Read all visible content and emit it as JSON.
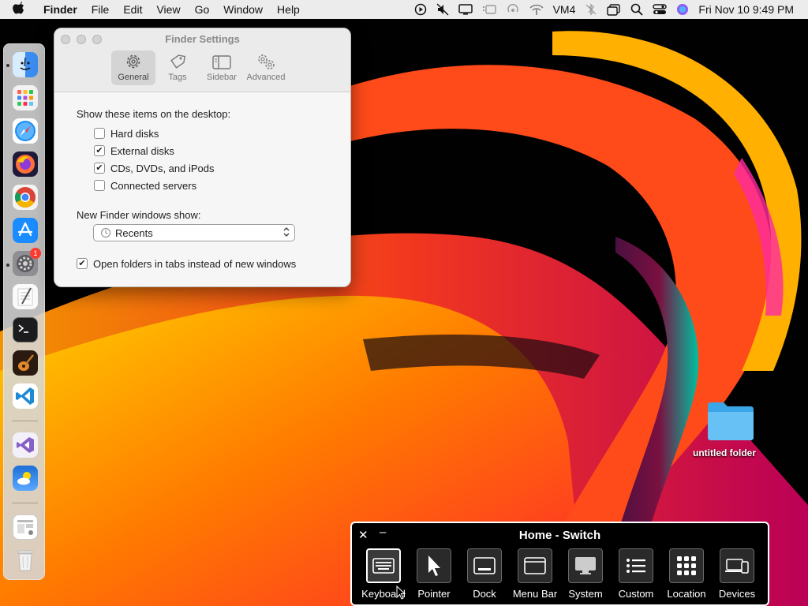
{
  "menubar": {
    "items": [
      "Finder",
      "File",
      "Edit",
      "View",
      "Go",
      "Window",
      "Help"
    ],
    "status_text": "VM4",
    "datetime": "Fri Nov 10  9:49 PM"
  },
  "dock": {
    "apps": [
      {
        "name": "finder-app",
        "glyph": "☺"
      },
      {
        "name": "launchpad-app",
        "glyph": "▦"
      },
      {
        "name": "safari-app",
        "glyph": "✦"
      },
      {
        "name": "firefox-app",
        "glyph": "●"
      },
      {
        "name": "chrome-app",
        "glyph": "◉"
      },
      {
        "name": "app-store-app",
        "glyph": "A"
      },
      {
        "name": "system-settings-app",
        "glyph": "⚙"
      },
      {
        "name": "textedit-app",
        "glyph": "✎"
      },
      {
        "name": "terminal-app",
        "glyph": ">_"
      },
      {
        "name": "garageband-app",
        "glyph": "♫"
      },
      {
        "name": "vscode-app",
        "glyph": "❮❯"
      },
      {
        "name": "visual-studio-app",
        "glyph": "∞"
      },
      {
        "name": "weather-app",
        "glyph": "☁"
      },
      {
        "name": "preview-app",
        "glyph": "▤"
      },
      {
        "name": "trash-app",
        "glyph": "🗑"
      }
    ],
    "settings_badge": "1"
  },
  "finder_settings": {
    "title": "Finder Settings",
    "tabs": [
      "General",
      "Tags",
      "Sidebar",
      "Advanced"
    ],
    "desktop_label": "Show these items on the desktop:",
    "desktop_items": [
      {
        "label": "Hard disks",
        "checked": false
      },
      {
        "label": "External disks",
        "checked": true
      },
      {
        "label": "CDs, DVDs, and iPods",
        "checked": true
      },
      {
        "label": "Connected servers",
        "checked": false
      }
    ],
    "new_window_label": "New Finder windows show:",
    "new_window_value": "Recents",
    "tabs_option": {
      "label": "Open folders in tabs instead of new windows",
      "checked": true
    }
  },
  "desktop": {
    "folder_label": "untitled folder"
  },
  "switch_panel": {
    "title": "Home - Switch",
    "close_glyph": "✕",
    "min_glyph": "–",
    "buttons": [
      "Keyboard",
      "Pointer",
      "Dock",
      "Menu Bar",
      "System",
      "Custom",
      "Location",
      "Devices"
    ]
  }
}
